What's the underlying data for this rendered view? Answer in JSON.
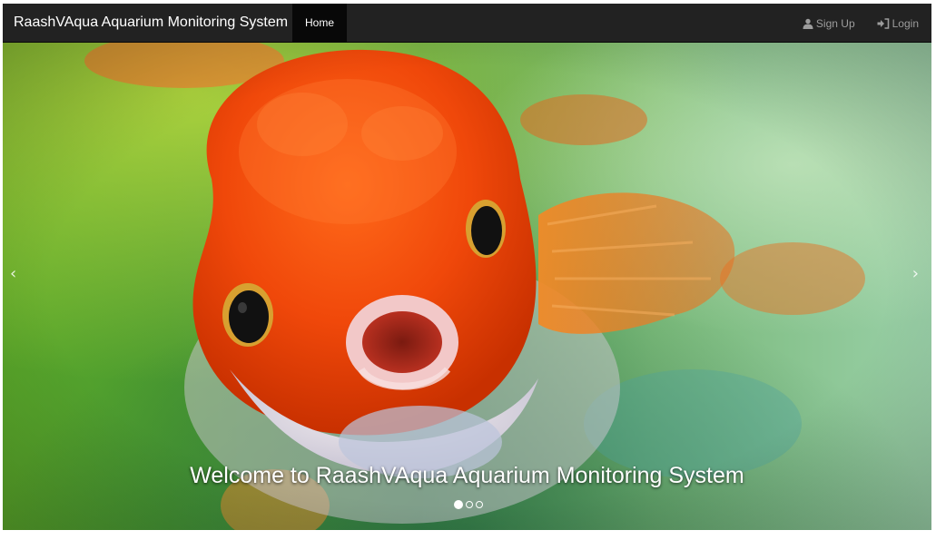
{
  "navbar": {
    "brand": "RaashVAqua Aquarium Monitoring System",
    "home_label": "Home",
    "signup_label": "Sign Up",
    "login_label": "Login"
  },
  "carousel": {
    "caption": "Welcome to RaashVAqua Aquarium Monitoring System",
    "prev_glyph": "‹",
    "next_glyph": "›",
    "slide_count": 3,
    "active_index": 0
  },
  "colors": {
    "navbar_bg": "#222222",
    "nav_active_bg": "#080808",
    "nav_link": "#9d9d9d",
    "caption_text": "#ffffff"
  },
  "icons": {
    "signup": "user-icon",
    "login": "login-icon"
  }
}
